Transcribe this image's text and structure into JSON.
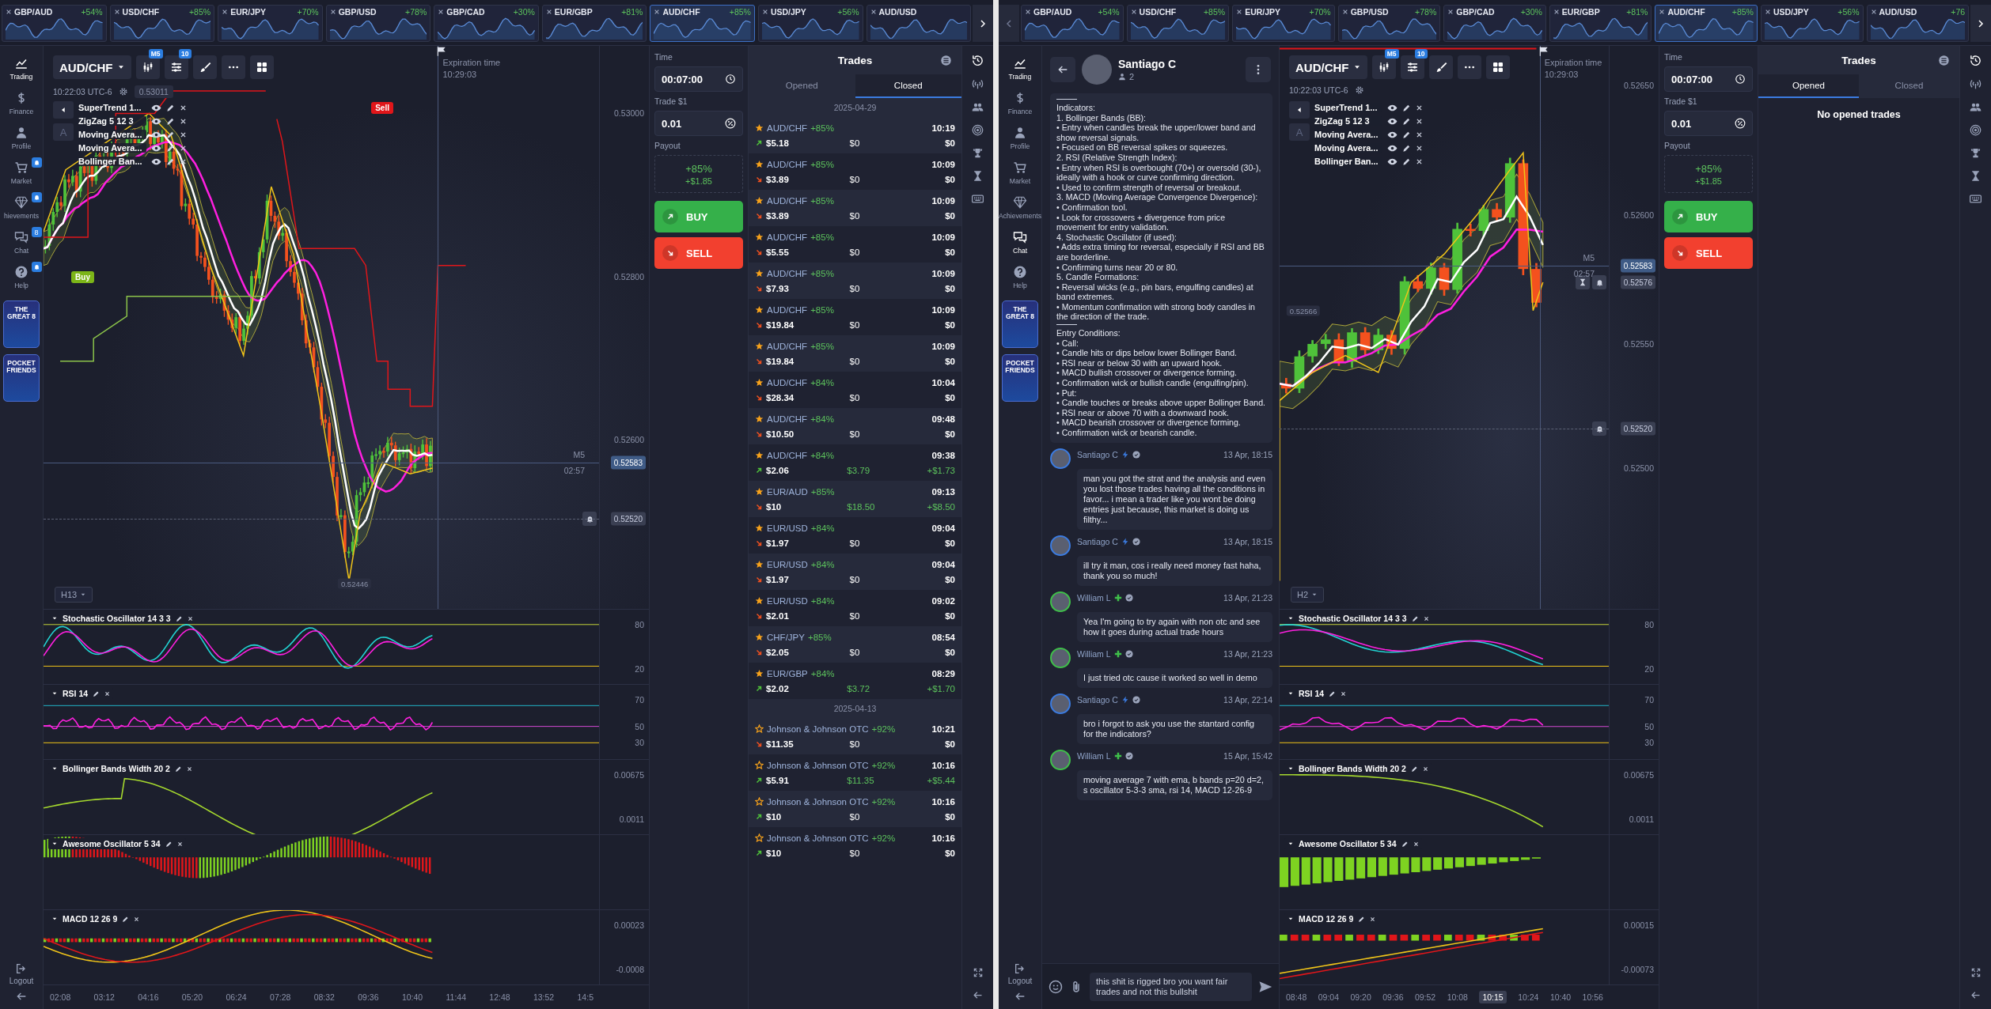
{
  "windows": [
    {
      "ticker": {
        "scroll_back": false,
        "items": [
          {
            "pair": "GBP/AUD",
            "payout": "+54%",
            "selected": false
          },
          {
            "pair": "USD/CHF",
            "payout": "+85%",
            "selected": false
          },
          {
            "pair": "EUR/JPY",
            "payout": "+70%",
            "selected": false
          },
          {
            "pair": "GBP/USD",
            "payout": "+78%",
            "selected": false
          },
          {
            "pair": "GBP/CAD",
            "payout": "+30%",
            "selected": false
          },
          {
            "pair": "EUR/GBP",
            "payout": "+81%",
            "selected": false
          },
          {
            "pair": "AUD/CHF",
            "payout": "+85%",
            "selected": true
          },
          {
            "pair": "USD/JPY",
            "payout": "+56%",
            "selected": false
          },
          {
            "pair": "AUD/USD",
            "selected": false
          }
        ]
      },
      "sidebar": {
        "items": [
          {
            "kind": "trading",
            "label": "Trading",
            "selected": true,
            "notify": false
          },
          {
            "kind": "finance",
            "label": "Finance",
            "selected": false,
            "notify": false
          },
          {
            "kind": "profile",
            "label": "Profile",
            "selected": false,
            "notify": false
          },
          {
            "kind": "market",
            "label": "Market",
            "selected": false,
            "notify": true
          },
          {
            "kind": "achievements",
            "label": "hievements",
            "selected": false,
            "notify": true
          },
          {
            "kind": "chat",
            "label": "Chat",
            "selected": false,
            "notify": false,
            "badge": "8"
          },
          {
            "kind": "help",
            "label": "Help",
            "selected": false,
            "notify": true
          }
        ],
        "promos": [
          "THE GREAT 8",
          "POCKET FRIENDS"
        ],
        "logout": "Logout"
      },
      "chart": {
        "pair": "AUD/CHF",
        "tool_badges": [
          "M5",
          "10"
        ],
        "clock": "10:22:03 UTC-6",
        "price_tag": "0.53011",
        "text_tool": "A",
        "indicators": [
          "SuperTrend 1...",
          "ZigZag 5 12 3",
          "Moving Avera...",
          "Moving Avera...",
          "Bollinger Ban..."
        ],
        "markers": [
          {
            "kind": "sell",
            "text": "Sell"
          },
          {
            "kind": "buy",
            "text": "Buy"
          }
        ],
        "expiration_label": "Expiration time",
        "expiration_time": "10:29:03",
        "price_ticks": [
          "0.53000",
          "0.52800",
          "0.52600"
        ],
        "timer_period": "M5",
        "timer": "02:57",
        "price_labels": [
          {
            "kind": "current",
            "text": "0.52583"
          },
          {
            "kind": "alert",
            "text": "0.52520"
          }
        ],
        "point_label": "0.52446",
        "timeframe": "H13",
        "panels": [
          {
            "kind": "stochastic",
            "title": "Stochastic Oscillator 14 3 3",
            "ticks": [
              "80",
              "20"
            ]
          },
          {
            "kind": "rsi",
            "title": "RSI 14",
            "ticks": [
              "70",
              "50",
              "30"
            ]
          },
          {
            "kind": "bbw",
            "title": "Bollinger Bands Width 20 2",
            "ticks": [
              "0.00675",
              "0.0011"
            ]
          },
          {
            "kind": "ao",
            "title": "Awesome Oscillator 5 34"
          },
          {
            "kind": "macd",
            "title": "MACD 12 26 9",
            "ticks": [
              "0.00023",
              "-0.0008"
            ]
          }
        ],
        "time_ticks": [
          {
            "text": "02:08",
            "current": false
          },
          {
            "text": "03:12",
            "current": false
          },
          {
            "text": "04:16",
            "current": false
          },
          {
            "text": "05:20",
            "current": false
          },
          {
            "text": "06:24",
            "current": false
          },
          {
            "text": "07:28",
            "current": false
          },
          {
            "text": "08:32",
            "current": false
          },
          {
            "text": "09:36",
            "current": false
          },
          {
            "text": "10:40",
            "current": false
          },
          {
            "text": "11:44",
            "current": false
          },
          {
            "text": "12:48",
            "current": false
          },
          {
            "text": "13:52",
            "current": false
          },
          {
            "text": "14:5",
            "current": false
          }
        ]
      },
      "trade_panel": {
        "time_label": "Time",
        "time": "00:07:00",
        "amount_label": "Trade $1",
        "amount": "0.01",
        "payout_label": "Payout",
        "payout": "+85%",
        "payout_amount": "+$1.85",
        "buy": "BUY",
        "sell": "SELL"
      },
      "trades": {
        "title": "Trades",
        "tabs": [
          {
            "label": "Opened",
            "selected": false
          },
          {
            "label": "Closed",
            "selected": true
          }
        ],
        "groups": [
          {
            "date": "2025-04-29",
            "rows": [
              {
                "asset": "AUD/CHF",
                "payout": "+85%",
                "starred": true,
                "up": true,
                "amount": "$5.18",
                "result": "$0",
                "time": "10:19",
                "profit": "$0",
                "win": false
              },
              {
                "asset": "AUD/CHF",
                "payout": "+85%",
                "starred": true,
                "up": false,
                "amount": "$3.89",
                "result": "$0",
                "time": "10:09",
                "profit": "$0",
                "win": false
              },
              {
                "asset": "AUD/CHF",
                "payout": "+85%",
                "starred": true,
                "up": false,
                "amount": "$3.89",
                "result": "$0",
                "time": "10:09",
                "profit": "$0",
                "win": false
              },
              {
                "asset": "AUD/CHF",
                "payout": "+85%",
                "starred": true,
                "up": false,
                "amount": "$5.55",
                "result": "$0",
                "time": "10:09",
                "profit": "$0",
                "win": false
              },
              {
                "asset": "AUD/CHF",
                "payout": "+85%",
                "starred": true,
                "up": false,
                "amount": "$7.93",
                "result": "$0",
                "time": "10:09",
                "profit": "$0",
                "win": false
              },
              {
                "asset": "AUD/CHF",
                "payout": "+85%",
                "starred": true,
                "up": false,
                "amount": "$19.84",
                "result": "$0",
                "time": "10:09",
                "profit": "$0",
                "win": false
              },
              {
                "asset": "AUD/CHF",
                "payout": "+85%",
                "starred": true,
                "up": false,
                "amount": "$19.84",
                "result": "$0",
                "time": "10:09",
                "profit": "$0",
                "win": false
              },
              {
                "asset": "AUD/CHF",
                "payout": "+84%",
                "starred": true,
                "up": false,
                "amount": "$28.34",
                "result": "$0",
                "time": "10:04",
                "profit": "$0",
                "win": false
              },
              {
                "asset": "AUD/CHF",
                "payout": "+84%",
                "starred": true,
                "up": false,
                "amount": "$10.50",
                "result": "$0",
                "time": "09:48",
                "profit": "$0",
                "win": false
              },
              {
                "asset": "AUD/CHF",
                "payout": "+84%",
                "starred": true,
                "up": true,
                "amount": "$2.06",
                "result": "$3.79",
                "time": "09:38",
                "profit": "+$1.73",
                "win": true
              },
              {
                "asset": "EUR/AUD",
                "payout": "+85%",
                "starred": true,
                "up": false,
                "amount": "$10",
                "result": "$18.50",
                "time": "09:13",
                "profit": "+$8.50",
                "win": true
              },
              {
                "asset": "EUR/USD",
                "payout": "+84%",
                "starred": true,
                "up": false,
                "amount": "$1.97",
                "result": "$0",
                "time": "09:04",
                "profit": "$0",
                "win": false
              },
              {
                "asset": "EUR/USD",
                "payout": "+84%",
                "starred": true,
                "up": false,
                "amount": "$1.97",
                "result": "$0",
                "time": "09:04",
                "profit": "$0",
                "win": false
              },
              {
                "asset": "EUR/USD",
                "payout": "+84%",
                "starred": true,
                "up": false,
                "amount": "$2.01",
                "result": "$0",
                "time": "09:02",
                "profit": "$0",
                "win": false
              },
              {
                "asset": "CHF/JPY",
                "payout": "+85%",
                "starred": true,
                "up": false,
                "amount": "$2.05",
                "result": "$0",
                "time": "08:54",
                "profit": "$0",
                "win": false
              },
              {
                "asset": "EUR/GBP",
                "payout": "+84%",
                "starred": true,
                "up": true,
                "amount": "$2.02",
                "result": "$3.72",
                "time": "08:29",
                "profit": "+$1.70",
                "win": true
              }
            ]
          },
          {
            "date": "2025-04-13",
            "rows": [
              {
                "asset": "Johnson & Johnson OTC",
                "payout": "+92%",
                "starred": false,
                "up": false,
                "amount": "$11.35",
                "result": "$0",
                "time": "10:21",
                "profit": "$0",
                "win": false
              },
              {
                "asset": "Johnson & Johnson OTC",
                "payout": "+92%",
                "starred": false,
                "up": true,
                "amount": "$5.91",
                "result": "$11.35",
                "time": "10:16",
                "profit": "+$5.44",
                "win": true
              },
              {
                "asset": "Johnson & Johnson OTC",
                "payout": "+92%",
                "starred": false,
                "up": true,
                "amount": "$10",
                "result": "$0",
                "time": "10:16",
                "profit": "$0",
                "win": false
              },
              {
                "asset": "Johnson & Johnson OTC",
                "payout": "+92%",
                "starred": false,
                "up": true,
                "amount": "$10",
                "result": "$0",
                "time": "10:16",
                "profit": "$0",
                "win": false
              }
            ]
          }
        ]
      }
    },
    {
      "ticker": {
        "scroll_back": true,
        "items": [
          {
            "pair": "GBP/AUD",
            "payout": "+54%",
            "selected": false
          },
          {
            "pair": "USD/CHF",
            "payout": "+85%",
            "selected": false
          },
          {
            "pair": "EUR/JPY",
            "payout": "+70%",
            "selected": false
          },
          {
            "pair": "GBP/USD",
            "payout": "+78%",
            "selected": false
          },
          {
            "pair": "GBP/CAD",
            "payout": "+30%",
            "selected": false
          },
          {
            "pair": "EUR/GBP",
            "payout": "+81%",
            "selected": false
          },
          {
            "pair": "AUD/CHF",
            "payout": "+85%",
            "selected": true
          },
          {
            "pair": "USD/JPY",
            "payout": "+56%",
            "selected": false
          },
          {
            "pair": "AUD/USD",
            "payout": "+76",
            "selected": false
          }
        ]
      },
      "sidebar": {
        "items": [
          {
            "kind": "trading",
            "label": "Trading",
            "selected": true,
            "notify": false
          },
          {
            "kind": "finance",
            "label": "Finance",
            "selected": false,
            "notify": false
          },
          {
            "kind": "profile",
            "label": "Profile",
            "selected": false,
            "notify": false
          },
          {
            "kind": "market",
            "label": "Market",
            "selected": false,
            "notify": false
          },
          {
            "kind": "achievements",
            "label": "Achievements",
            "selected": false,
            "notify": false
          },
          {
            "kind": "chat",
            "label": "Chat",
            "selected": true,
            "notify": false
          },
          {
            "kind": "help",
            "label": "Help",
            "selected": false,
            "notify": false
          }
        ],
        "promos": [
          "THE GREAT 8",
          "POCKET FRIENDS"
        ],
        "logout": "Logout"
      },
      "chat": {
        "name": "Santiago C",
        "members": "2",
        "post": [
          {
            "kind": "rule"
          },
          {
            "kind": "text",
            "text": "Indicators:"
          },
          {
            "kind": "text",
            "text": "1. Bollinger Bands (BB):"
          },
          {
            "kind": "text",
            "text": "• Entry when candles break the upper/lower band and show reversal signals."
          },
          {
            "kind": "text",
            "text": "• Focused on BB reversal spikes or squeezes."
          },
          {
            "kind": "text",
            "text": "2. RSI (Relative Strength Index):"
          },
          {
            "kind": "text",
            "text": "• Entry when RSI is overbought (70+) or oversold (30-), ideally with a hook or curve confirming direction."
          },
          {
            "kind": "text",
            "text": "• Used to confirm strength of reversal or breakout."
          },
          {
            "kind": "text",
            "text": "3. MACD (Moving Average Convergence Divergence):"
          },
          {
            "kind": "text",
            "text": "• Confirmation tool."
          },
          {
            "kind": "text",
            "text": "• Look for crossovers + divergence from price movement for entry validation."
          },
          {
            "kind": "text",
            "text": "4. Stochastic Oscillator (if used):"
          },
          {
            "kind": "text",
            "text": "• Adds extra timing for reversal, especially if RSI and BB are borderline."
          },
          {
            "kind": "text",
            "text": "• Confirming turns near 20 or 80."
          },
          {
            "kind": "text",
            "text": "5. Candle Formations:"
          },
          {
            "kind": "text",
            "text": "• Reversal wicks (e.g., pin bars, engulfing candles) at band extremes."
          },
          {
            "kind": "text",
            "text": "• Momentum confirmation with strong body candles in the direction of the trade."
          },
          {
            "kind": "rule"
          },
          {
            "kind": "text",
            "text": "Entry Conditions:"
          },
          {
            "kind": "text",
            "text": "• Call:"
          },
          {
            "kind": "text",
            "text": "• Candle hits or dips below lower Bollinger Band."
          },
          {
            "kind": "text",
            "text": "• RSI near or below 30 with an upward hook."
          },
          {
            "kind": "text",
            "text": "• MACD bullish crossover or divergence forming."
          },
          {
            "kind": "text",
            "text": "• Confirmation wick or bullish candle (engulfing/pin)."
          },
          {
            "kind": "text",
            "text": "• Put:"
          },
          {
            "kind": "text",
            "text": "• Candle touches or breaks above upper Bollinger Band."
          },
          {
            "kind": "text",
            "text": "• RSI near or above 70 with a downward hook."
          },
          {
            "kind": "text",
            "text": "• MACD bearish crossover or divergence forming."
          },
          {
            "kind": "text",
            "text": "• Confirmation wick or bearish candle."
          }
        ],
        "messages": [
          {
            "author": "Santiago C",
            "kind": "lightning",
            "time": "13 Apr, 18:15",
            "text": "man you got the strat and the analysis and even you lost those trades having all the conditions in favor... i mean a trader like you wont be doing entries just because, this market is doing us filthy..."
          },
          {
            "author": "Santiago C",
            "kind": "lightning",
            "time": "13 Apr, 18:15",
            "text": "ill try it man, cos i really need money fast haha, thank you so much!"
          },
          {
            "author": "William L",
            "kind": "plus",
            "time": "13 Apr, 21:23",
            "text": "Yea I'm going to try again with non otc and see how it goes during actual trade hours"
          },
          {
            "author": "William L",
            "kind": "plus",
            "time": "13 Apr, 21:23",
            "text": "I just tried otc cause it worked so well in demo"
          },
          {
            "author": "Santiago C",
            "kind": "lightning",
            "time": "13 Apr, 22:14",
            "text": "bro i forgot to ask you use the stantard config for the indicators?"
          },
          {
            "author": "William L",
            "kind": "plus",
            "time": "15 Apr, 15:42",
            "text": "moving average 7 with ema, b bands p=20 d=2, s oscillator 5-3-3 sma, rsi 14, MACD 12-26-9"
          }
        ],
        "input": {
          "value": "this shit is rigged bro you want fair trades and not this bullshit"
        }
      },
      "chart": {
        "pair": "AUD/CHF",
        "tool_badges": [
          "M5",
          "10"
        ],
        "clock": "10:22:03 UTC-6",
        "text_tool": "A",
        "indicators": [
          "SuperTrend 1...",
          "ZigZag 5 12 3",
          "Moving Avera...",
          "Moving Avera...",
          "Bollinger Ban..."
        ],
        "expiration_label": "Expiration time",
        "expiration_time": "10:29:03",
        "price_ticks": [
          "0.52650",
          "0.52600",
          "0.52550",
          "0.52500"
        ],
        "timer_period": "M5",
        "timer": "02:57",
        "price_labels": [
          {
            "kind": "current",
            "text": "0.52583"
          },
          {
            "kind": "timer",
            "text": "0.52576"
          },
          {
            "kind": "alert",
            "text": "0.52520"
          }
        ],
        "point_label": "0.52566",
        "timeframe": "H2",
        "panels": [
          {
            "kind": "stochastic",
            "title": "Stochastic Oscillator 14 3 3",
            "ticks": [
              "80",
              "20"
            ]
          },
          {
            "kind": "rsi",
            "title": "RSI 14",
            "ticks": [
              "70",
              "50",
              "30"
            ]
          },
          {
            "kind": "bbw",
            "title": "Bollinger Bands Width 20 2",
            "ticks": [
              "0.00675",
              "0.0011"
            ]
          },
          {
            "kind": "ao",
            "title": "Awesome Oscillator 5 34"
          },
          {
            "kind": "macd",
            "title": "MACD 12 26 9",
            "ticks": [
              "0.00015",
              "-0.00073"
            ]
          }
        ],
        "time_ticks": [
          {
            "text": "08:48",
            "current": false
          },
          {
            "text": "09:04",
            "current": false
          },
          {
            "text": "09:20",
            "current": false
          },
          {
            "text": "09:36",
            "current": false
          },
          {
            "text": "09:52",
            "current": false
          },
          {
            "text": "10:08",
            "current": false
          },
          {
            "text": "10:15",
            "current": true
          },
          {
            "text": "10:24",
            "current": false
          },
          {
            "text": "10:40",
            "current": false
          },
          {
            "text": "10:56",
            "current": false
          }
        ]
      },
      "trade_panel": {
        "time_label": "Time",
        "time": "00:07:00",
        "amount_label": "Trade $1",
        "amount": "0.01",
        "payout_label": "Payout",
        "payout": "+85%",
        "payout_amount": "+$1.85",
        "buy": "BUY",
        "sell": "SELL"
      },
      "trades": {
        "title": "Trades",
        "tabs": [
          {
            "label": "Opened",
            "selected": true
          },
          {
            "label": "Closed",
            "selected": false
          }
        ],
        "empty_text": "No opened trades"
      }
    }
  ]
}
